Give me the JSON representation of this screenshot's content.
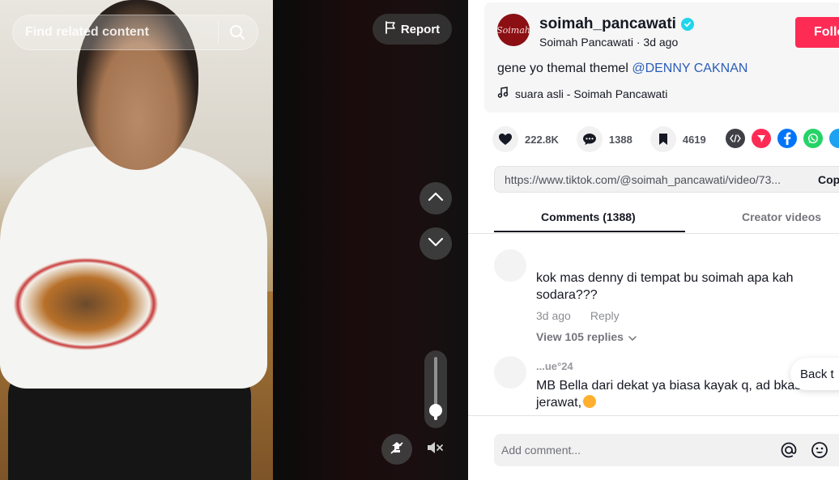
{
  "search": {
    "placeholder": "Find related content"
  },
  "video": {
    "report_label": "Report",
    "volume_level": 0.15
  },
  "author": {
    "username": "soimah_pancawati",
    "display_name": "Soimah Pancawati",
    "posted": "3d ago",
    "avatar_text": "Soimah",
    "verified": true,
    "follow_label": "Follo"
  },
  "post": {
    "caption": "gene yo themal themel ",
    "mention": "@DENNY CAKNAN",
    "music": "suara asli - Soimah Pancawati"
  },
  "actions": {
    "likes": "222.8K",
    "comments": "1388",
    "saves": "4619"
  },
  "share_icons": [
    "embed-icon",
    "send-icon",
    "facebook-icon",
    "whatsapp-icon",
    "twitter-icon"
  ],
  "link": {
    "url": "https://www.tiktok.com/@soimah_pancawati/video/73...",
    "copy_label": "Copy"
  },
  "tabs": {
    "comments": "Comments (1388)",
    "creator": "Creator videos"
  },
  "comments": [
    {
      "text": "kok mas denny di tempat bu soimah apa kah sodara???",
      "time": "3d ago",
      "reply": "Reply",
      "view_replies": "View 105 replies"
    },
    {
      "name": "...ue°24",
      "text": "MB Bella dari dekat ya biasa kayak q, ad bkas jerawat,",
      "emoji": "smiling-face-emoji"
    }
  ],
  "back_to_top": "Back t",
  "comment_box": {
    "placeholder": "Add comment..."
  },
  "colors": {
    "brand": "#fe2c55",
    "mention": "#2b5db9",
    "verified": "#20d5ec"
  }
}
